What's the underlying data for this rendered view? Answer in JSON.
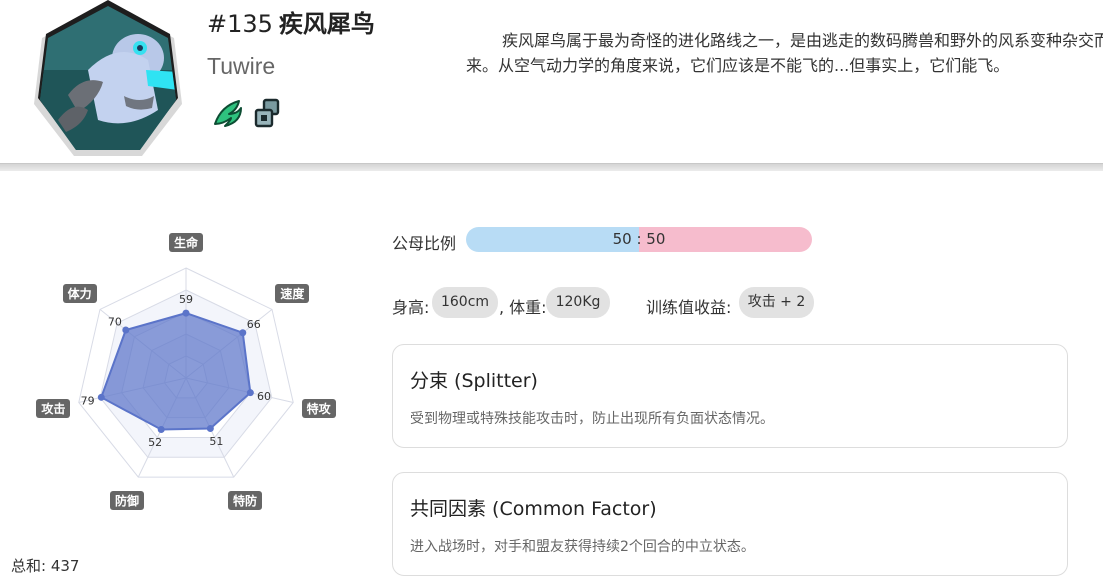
{
  "pokemon": {
    "number": "#135",
    "name": "疾风犀鸟",
    "name_en": "Tuwire",
    "description": "疾风犀鸟属于最为奇怪的进化路线之一，是由逃走的数码腾兽和野外的风系变种杂交而来。从空气动力学的角度来说，它们应该是不能飞的...但事实上，它们能飞。",
    "types": [
      {
        "icon": "wind-type-icon",
        "color": "#2ec27e"
      },
      {
        "icon": "digital-type-icon",
        "color": "#7a9aa0"
      }
    ]
  },
  "stats": {
    "labels": {
      "hp": "生命",
      "speed": "速度",
      "sp_atk": "特攻",
      "sp_def": "特防",
      "defense": "防御",
      "attack": "攻击",
      "stamina": "体力"
    },
    "values": {
      "hp": 59,
      "speed": 66,
      "sp_atk": 60,
      "sp_def": 51,
      "defense": 52,
      "attack": 79,
      "stamina": 70
    },
    "max": 100,
    "total_label": "总和: 437",
    "fill_color": "#5b74c9"
  },
  "gender": {
    "label": "公母比例",
    "male_ratio": 50,
    "female_ratio": 50,
    "text": "50 : 50",
    "male_color": "#b8dcf5",
    "female_color": "#f6bccd"
  },
  "physical": {
    "height_label": "身高:",
    "height": "160cm",
    "weight_label": ", 体重:",
    "weight": "120Kg",
    "ev_label": "训练值收益:",
    "ev": "攻击 + 2"
  },
  "abilities": [
    {
      "name": "分束 (Splitter)",
      "description": "受到物理或特殊技能攻击时，防止出现所有负面状态情况。"
    },
    {
      "name": "共同因素 (Common Factor)",
      "description": "进入战场时，对手和盟友获得持续2个回合的中立状态。"
    }
  ]
}
